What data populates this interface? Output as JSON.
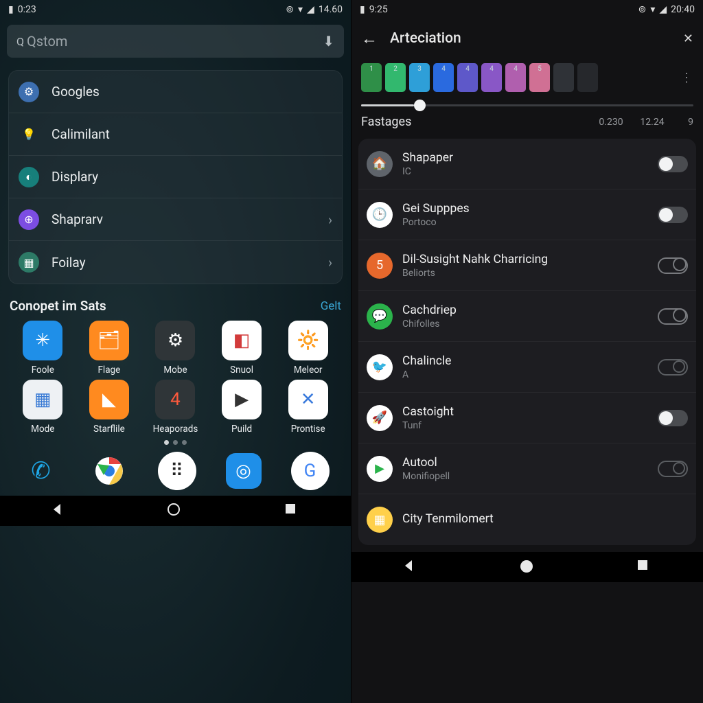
{
  "left": {
    "status": {
      "time": "0:23",
      "battery": "14.60"
    },
    "search": {
      "placeholder": "Qstom"
    },
    "quick": [
      {
        "label": "Googles"
      },
      {
        "label": "Calimilant"
      },
      {
        "label": "Displary"
      },
      {
        "label": "Shaprarv",
        "chevron": true
      },
      {
        "label": "Foilay",
        "chevron": true
      }
    ],
    "section": {
      "title": "Conopet im Sats",
      "action": "Gelt"
    },
    "apps": [
      {
        "label": "Foole",
        "bg": "#1f8fe8",
        "glyph": "✳"
      },
      {
        "label": "Flage",
        "bg": "#ff8a1f",
        "glyph": "🗂"
      },
      {
        "label": "Mobe",
        "bg": "#2f3538",
        "glyph": "⚙"
      },
      {
        "label": "Snuol",
        "bg": "#ffffff",
        "glyph": "◧",
        "fg": "#d23b3b"
      },
      {
        "label": "Meleor",
        "bg": "#ffffff",
        "glyph": "🔆",
        "fg": "#ff9a2e"
      },
      {
        "label": "Mode",
        "bg": "#eef1f4",
        "glyph": "▦",
        "fg": "#3a7bd5"
      },
      {
        "label": "Starflile",
        "bg": "#ff8a1f",
        "glyph": "◣"
      },
      {
        "label": "Heaporads",
        "bg": "#2f3538",
        "glyph": "4",
        "fg": "#ff5a3c"
      },
      {
        "label": "Puild",
        "bg": "#ffffff",
        "glyph": "▶",
        "fg": "#333"
      },
      {
        "label": "Prontise",
        "bg": "#ffffff",
        "glyph": "✕",
        "fg": "#3b7bdc"
      }
    ]
  },
  "right": {
    "status": {
      "time": "9:25",
      "battery": "20:40"
    },
    "header": {
      "title": "Arteciation"
    },
    "palette": {
      "swatches": [
        {
          "c": "#2f8f48",
          "n": "1"
        },
        {
          "c": "#32b86e",
          "n": "2"
        },
        {
          "c": "#2e9fd8",
          "n": "3"
        },
        {
          "c": "#2a6adf",
          "n": "4"
        },
        {
          "c": "#5e58c9",
          "n": "4"
        },
        {
          "c": "#8957c6",
          "n": "4"
        },
        {
          "c": "#b05fae",
          "n": "4"
        },
        {
          "c": "#d07094",
          "n": "5"
        },
        {
          "c": "#2f3237",
          "n": ""
        },
        {
          "c": "#26282c",
          "n": ""
        }
      ]
    },
    "slider": {
      "label": "Fastages",
      "t1": "0.230",
      "t2": "12.24",
      "t3": "9"
    },
    "settings": [
      {
        "title": "Shapaper",
        "sub": "IC",
        "state": "on",
        "ic": "#5f646b",
        "glyph": "🏠"
      },
      {
        "title": "Gei Supppes",
        "sub": "Portoco",
        "state": "on",
        "ic": "#ffffff",
        "glyph": "🕒",
        "fg": "#e89b2d"
      },
      {
        "title": "Dil-Susight Nahk Charricing",
        "sub": "Beliorts",
        "state": "outline",
        "ic": "#e6682c",
        "glyph": "5"
      },
      {
        "title": "Cachdriep",
        "sub": "Chifolles",
        "state": "outline",
        "ic": "#2bb34b",
        "glyph": "💬"
      },
      {
        "title": "Chalincle",
        "sub": "A",
        "state": "off",
        "ic": "#ffffff",
        "glyph": "🐦",
        "fg": "#2b9fe8"
      },
      {
        "title": "Castoight",
        "sub": "Tunf",
        "state": "on",
        "ic": "#ffffff",
        "glyph": "🚀",
        "fg": "#e2473f"
      },
      {
        "title": "Autool",
        "sub": "Monifiopell",
        "state": "off",
        "ic": "#ffffff",
        "glyph": "▶",
        "fg": "#2bb34b"
      },
      {
        "title": "City Tenmilomert",
        "sub": "",
        "state": "none",
        "ic": "#ffd04a",
        "glyph": "▦"
      }
    ]
  }
}
